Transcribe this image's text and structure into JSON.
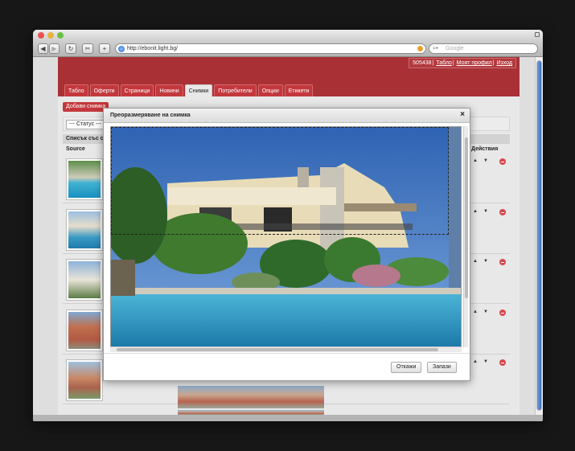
{
  "browser": {
    "url": "http://ebonit.light.bg/",
    "search_placeholder": "Google"
  },
  "header": {
    "user_id": "505438",
    "links": [
      "Табло",
      "Моят профил",
      "Изход"
    ]
  },
  "tabs": [
    "Табло",
    "Оферти",
    "Страници",
    "Новини",
    "Снимки",
    "Потребители",
    "Опции",
    "Етикети"
  ],
  "active_tab": "Снимки",
  "add_button": "Добави снимка",
  "filter": {
    "status_select": "--- Статус ---"
  },
  "list": {
    "title": "Списък със с",
    "col_source": "Source",
    "col_actions": "Действия"
  },
  "dialog": {
    "title": "Преоразмеряване на снимка",
    "close": "×",
    "cancel": "Откажи",
    "save": "Запази"
  },
  "colors": {
    "brand": "#a93136",
    "tab": "#c3383d"
  }
}
